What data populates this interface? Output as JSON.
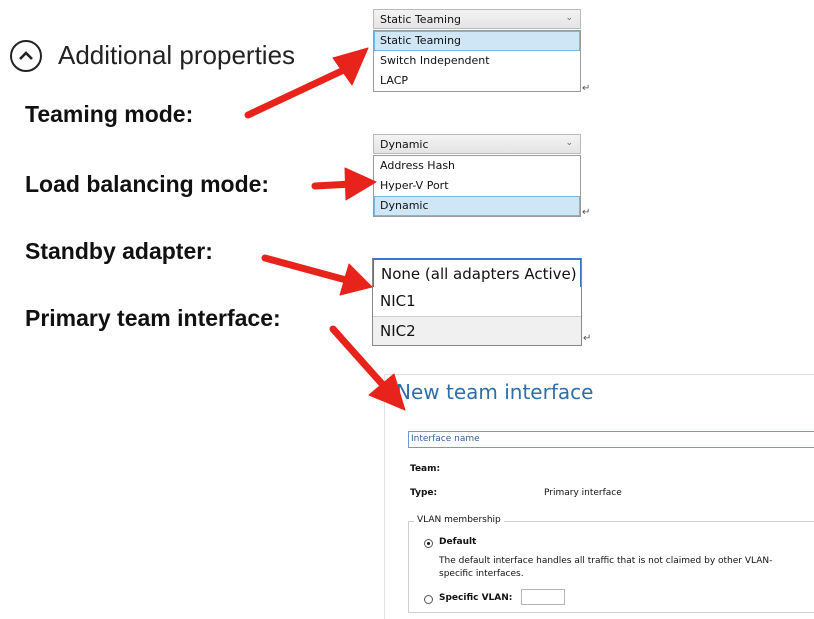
{
  "additional_properties": {
    "title": "Additional properties"
  },
  "labels": {
    "teaming_mode": "Teaming mode:",
    "load_balancing_mode": "Load balancing mode:",
    "standby_adapter": "Standby adapter:",
    "primary_team_interface": "Primary team interface:"
  },
  "teaming_dropdown": {
    "selected": "Static Teaming",
    "options": [
      "Static Teaming",
      "Switch Independent",
      "LACP"
    ]
  },
  "load_balancing_dropdown": {
    "selected": "Dynamic",
    "options": [
      "Address Hash",
      "Hyper-V Port",
      "Dynamic"
    ]
  },
  "standby_list": {
    "options": [
      "None (all adapters Active)",
      "NIC1",
      "NIC2"
    ]
  },
  "new_team_interface": {
    "title": "New team interface",
    "interface_name_placeholder": "Interface name",
    "team_label": "Team:",
    "type_label": "Type:",
    "type_value": "Primary interface",
    "vlan_membership_legend": "VLAN membership",
    "default_label": "Default",
    "default_description_line1": "The default interface handles all traffic that is not claimed by other VLAN-",
    "default_description_line2": "specific interfaces.",
    "specific_vlan_label": "Specific VLAN:"
  },
  "colors": {
    "arrow": "#e8231b",
    "selection": "#cfe6f7",
    "dialog_title": "#2f6fa8"
  },
  "icons": {
    "collapse": "chevron-up-circle-icon",
    "dropdown": "chevron-down-icon",
    "return": "return-glyph-icon"
  }
}
